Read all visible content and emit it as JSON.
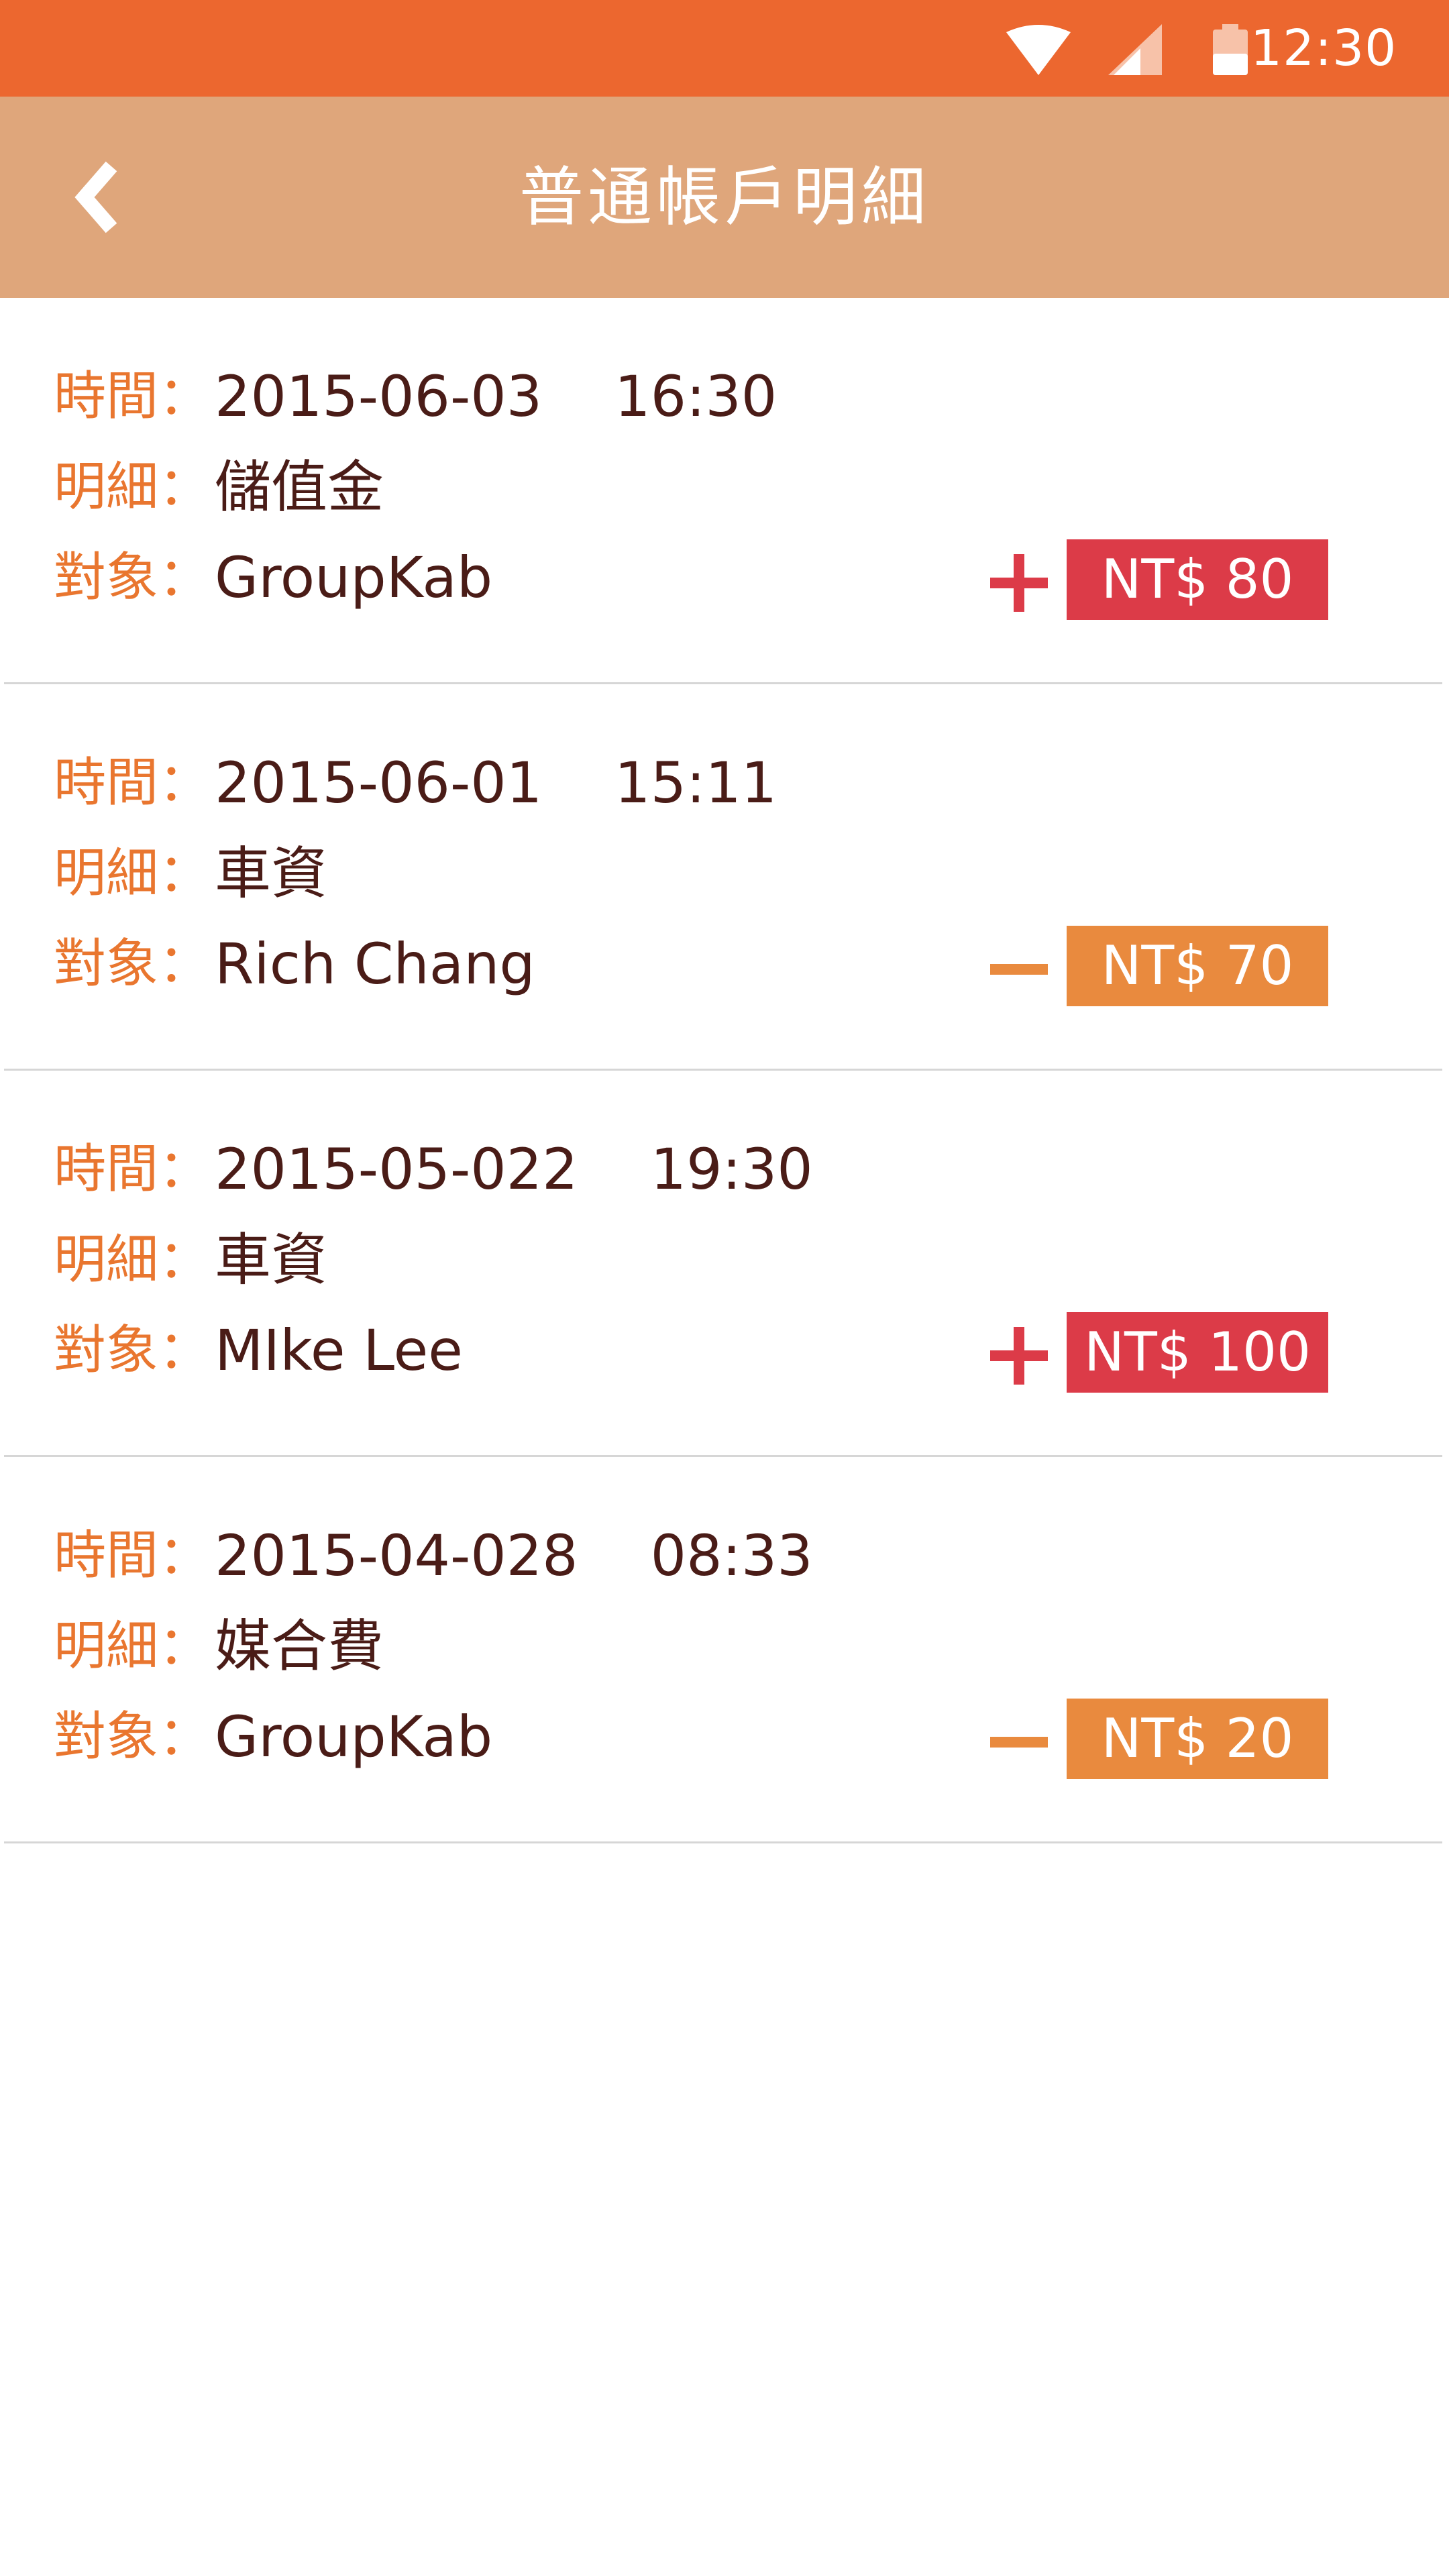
{
  "status_bar": {
    "time": "12:30",
    "icons": [
      "wifi-icon",
      "signal-icon",
      "battery-icon"
    ]
  },
  "header": {
    "title": "普通帳戶明細",
    "back_icon": "chevron-left-icon"
  },
  "labels": {
    "time": "時間：",
    "detail": "明細：",
    "counterparty": "對象："
  },
  "colors": {
    "status_bar": "#ec672f",
    "header": "#dfa67b",
    "label": "#e9762f",
    "value": "#4a1c17",
    "credit": "#dc3b48",
    "debit": "#e98a3e"
  },
  "transactions": [
    {
      "date": "2015-06-03",
      "time": "16:30",
      "detail": "儲值金",
      "counterparty": "GroupKab",
      "direction": "credit",
      "amount": "NT$ 80"
    },
    {
      "date": "2015-06-01",
      "time": "15:11",
      "detail": "車資",
      "counterparty": "Rich Chang",
      "direction": "debit",
      "amount": "NT$ 70"
    },
    {
      "date": "2015-05-022",
      "time": "19:30",
      "detail": "車資",
      "counterparty": "MIke Lee",
      "direction": "credit",
      "amount": "NT$ 100"
    },
    {
      "date": "2015-04-028",
      "time": "08:33",
      "detail": "媒合費",
      "counterparty": "GroupKab",
      "direction": "debit",
      "amount": "NT$ 20"
    }
  ]
}
